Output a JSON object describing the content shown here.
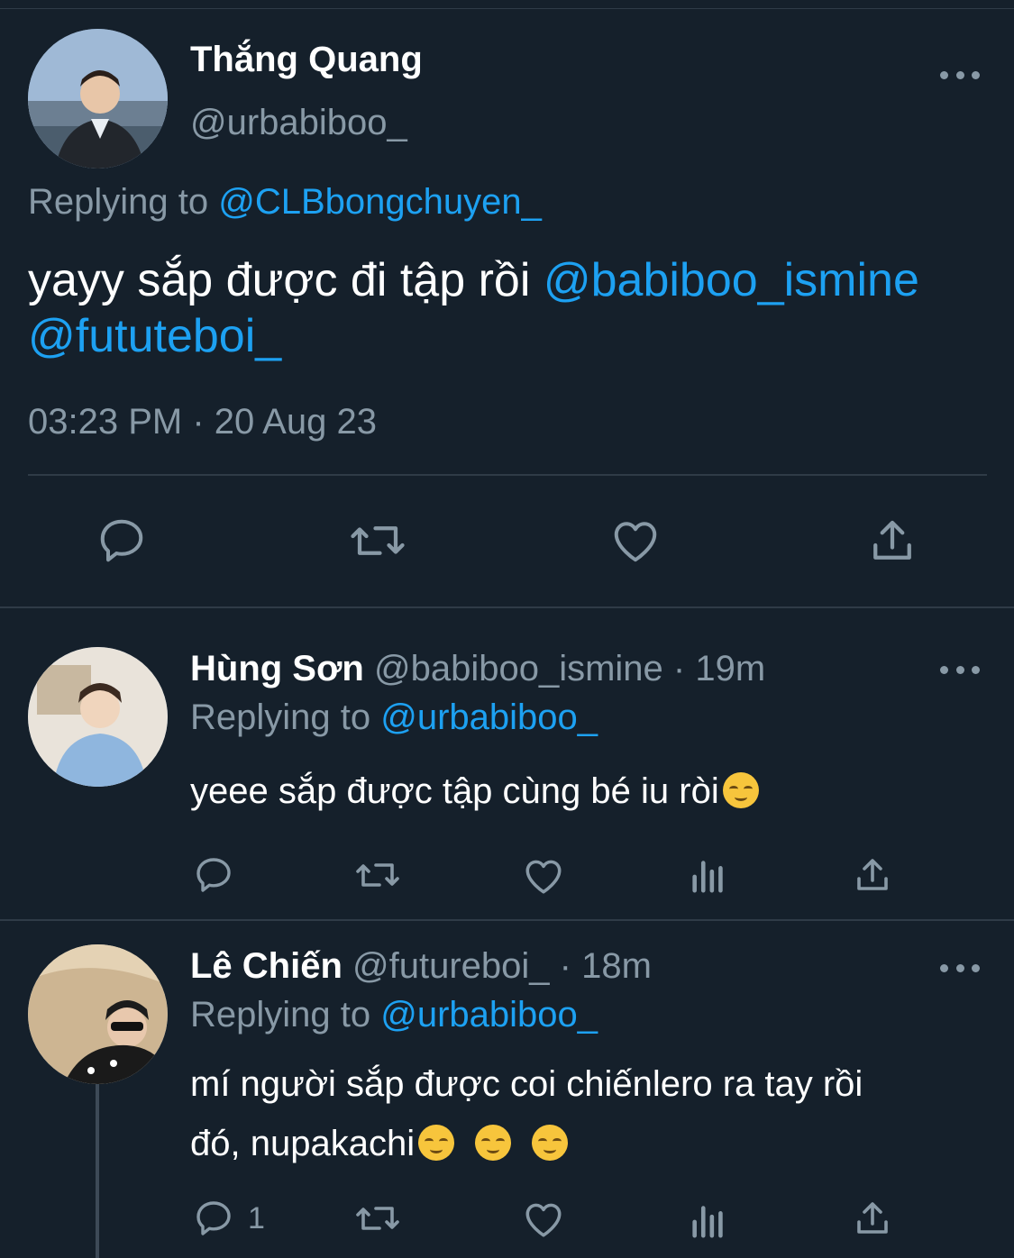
{
  "main_tweet": {
    "name": "Thắng Quang",
    "handle": "@urbabiboo_",
    "replying_prefix": "Replying to ",
    "replying_to": "@CLBbongchuyen_",
    "text": "yayy sắp được đi tập rồi ",
    "mention_1": "@babiboo_ismine",
    "mention_2": "@fututeboi_",
    "timestamp": "03:23 PM · 20 Aug 23"
  },
  "replies": [
    {
      "name": "Hùng Sơn",
      "meta": "@babiboo_ismine · 19m",
      "replying_prefix": "Replying to ",
      "replying_to": "@urbabiboo_",
      "text": "yeee sắp được tập cùng bé iu ròi",
      "reply_count": ""
    },
    {
      "name": "Lê Chiến",
      "meta": "@futureboi_ · 18m",
      "replying_prefix": "Replying to ",
      "replying_to": "@urbabiboo_",
      "text_line1": "mí người sắp được coi chiếnlero ra tay rồi",
      "text_line2": "đó, nupakachi",
      "reply_count": "1"
    }
  ],
  "icons": [
    "reply-icon",
    "retweet-icon",
    "like-icon",
    "share-icon",
    "analytics-icon",
    "more-icon"
  ],
  "colors": {
    "background": "#15202b",
    "accent": "#1da1f2",
    "muted": "#8899a6",
    "divider": "#2f3b47"
  }
}
